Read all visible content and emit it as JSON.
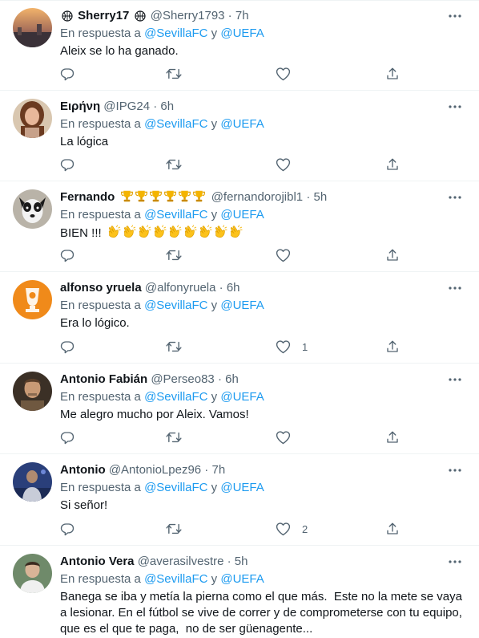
{
  "colors": {
    "accent": "#1d9bf0",
    "secondary": "#536471",
    "text": "#0f1419",
    "divider": "#eff3f4"
  },
  "icons": {
    "reply": "reply-icon",
    "retweet": "retweet-icon",
    "like": "heart-icon",
    "share": "share-icon",
    "more": "more-icon"
  },
  "replies": [
    {
      "name": "Sherry17",
      "name_prefix_emoji": "basketball-emoji",
      "name_suffix_emoji": "basketball-emoji",
      "handle": "@Sherry1793",
      "time": "7h",
      "replying_prefix": "En respuesta a ",
      "mention1": "@SevillaFC",
      "joiner": " y ",
      "mention2": "@UEFA",
      "text": "Aleix se lo ha ganado.",
      "likes": ""
    },
    {
      "name": "Ειρήνη",
      "handle": "@IPG24",
      "time": "6h",
      "replying_prefix": "En respuesta a ",
      "mention1": "@SevillaFC",
      "joiner": " y ",
      "mention2": "@UEFA",
      "text": "La lógica",
      "likes": ""
    },
    {
      "name": "Fernando",
      "name_emojis": [
        "trophy-emoji",
        "trophy-emoji",
        "trophy-emoji",
        "trophy-emoji",
        "trophy-emoji",
        "trophy-emoji"
      ],
      "handle": "@fernandorojibl1",
      "time": "5h",
      "replying_prefix": "En respuesta a ",
      "mention1": "@SevillaFC",
      "joiner": " y ",
      "mention2": "@UEFA",
      "text": "BIEN !!!",
      "text_emojis": [
        "clapping-hands-emoji",
        "clapping-hands-emoji",
        "clapping-hands-emoji",
        "clapping-hands-emoji",
        "clapping-hands-emoji",
        "clapping-hands-emoji",
        "clapping-hands-emoji",
        "clapping-hands-emoji",
        "clapping-hands-emoji"
      ],
      "likes": ""
    },
    {
      "name": "alfonso yruela",
      "handle": "@alfonyruela",
      "time": "6h",
      "replying_prefix": "En respuesta a ",
      "mention1": "@SevillaFC",
      "joiner": " y ",
      "mention2": "@UEFA",
      "text": "Era lo lógico.",
      "likes": "1"
    },
    {
      "name": "Antonio Fabián",
      "handle": "@Perseo83",
      "time": "6h",
      "replying_prefix": "En respuesta a ",
      "mention1": "@SevillaFC",
      "joiner": " y ",
      "mention2": "@UEFA",
      "text": "Me alegro mucho por Aleix. Vamos!",
      "likes": ""
    },
    {
      "name": "Antonio",
      "handle": "@AntonioLpez96",
      "time": "7h",
      "replying_prefix": "En respuesta a ",
      "mention1": "@SevillaFC",
      "joiner": " y ",
      "mention2": "@UEFA",
      "text": "Si señor!",
      "likes": "2"
    },
    {
      "name": "Antonio Vera",
      "handle": "@averasilvestre",
      "time": "5h",
      "replying_prefix": "En respuesta a ",
      "mention1": "@SevillaFC",
      "joiner": " y ",
      "mention2": "@UEFA",
      "text": "Banega se iba y metía la pierna como el que más.  Este no la mete se vaya a lesionar. En el fútbol se vive de correr y de comprometerse con tu equipo, que es el que te paga,  no de ser güenagente...",
      "likes": ""
    }
  ]
}
